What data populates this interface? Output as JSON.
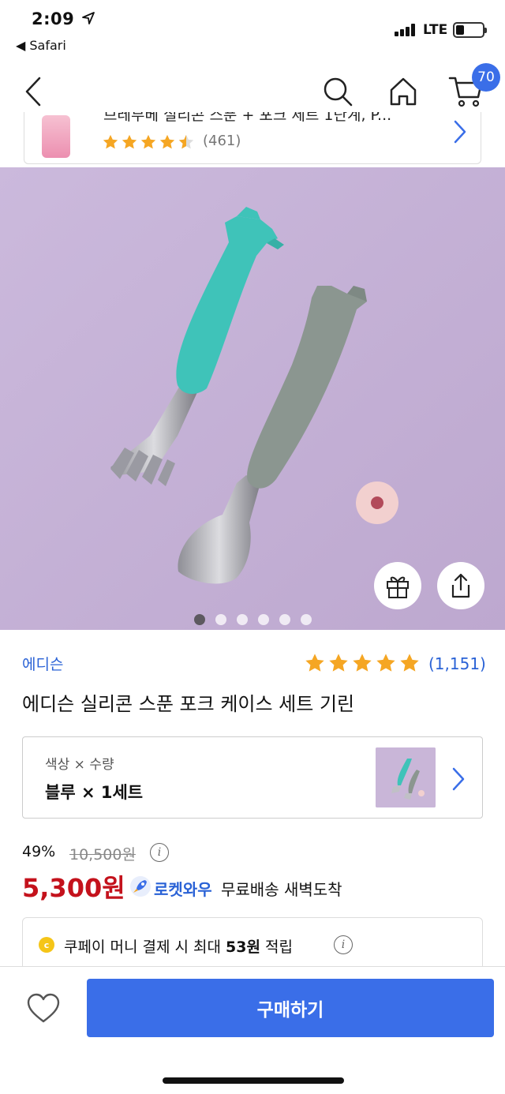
{
  "status_bar": {
    "time": "2:09",
    "back_app": "◀ Safari",
    "network": "LTE"
  },
  "nav": {
    "cart_count": "70"
  },
  "related_product": {
    "title": "브레부베 실리콘 스푼 + 포크 세트 1단계, P...",
    "rating": 4.5,
    "review_count": "(461)"
  },
  "hero": {
    "slide_count": 6,
    "active_slide": 1
  },
  "product": {
    "brand": "에디슨",
    "rating": 5,
    "review_count": "(1,151)",
    "title": "에디슨 실리콘 스푼 포크 케이스 세트 기린"
  },
  "option": {
    "label": "색상 × 수량",
    "value": "블루 × 1세트"
  },
  "pricing": {
    "discount": "49%",
    "original_price": "10,500원",
    "price": "5,300원",
    "rocket_label": "로켓와우",
    "delivery": "무료배송 새벽도착"
  },
  "cash": {
    "prefix": "쿠페이 머니 결제 시 최대 ",
    "amount": "53원",
    "suffix": " 적립"
  },
  "bottom": {
    "buy_label": "구매하기"
  },
  "colors": {
    "accent": "#3a6ee8",
    "link": "#2a62d6",
    "price": "#c4121c",
    "star": "#f5a623",
    "hero_bg": "#c9b6d8"
  }
}
